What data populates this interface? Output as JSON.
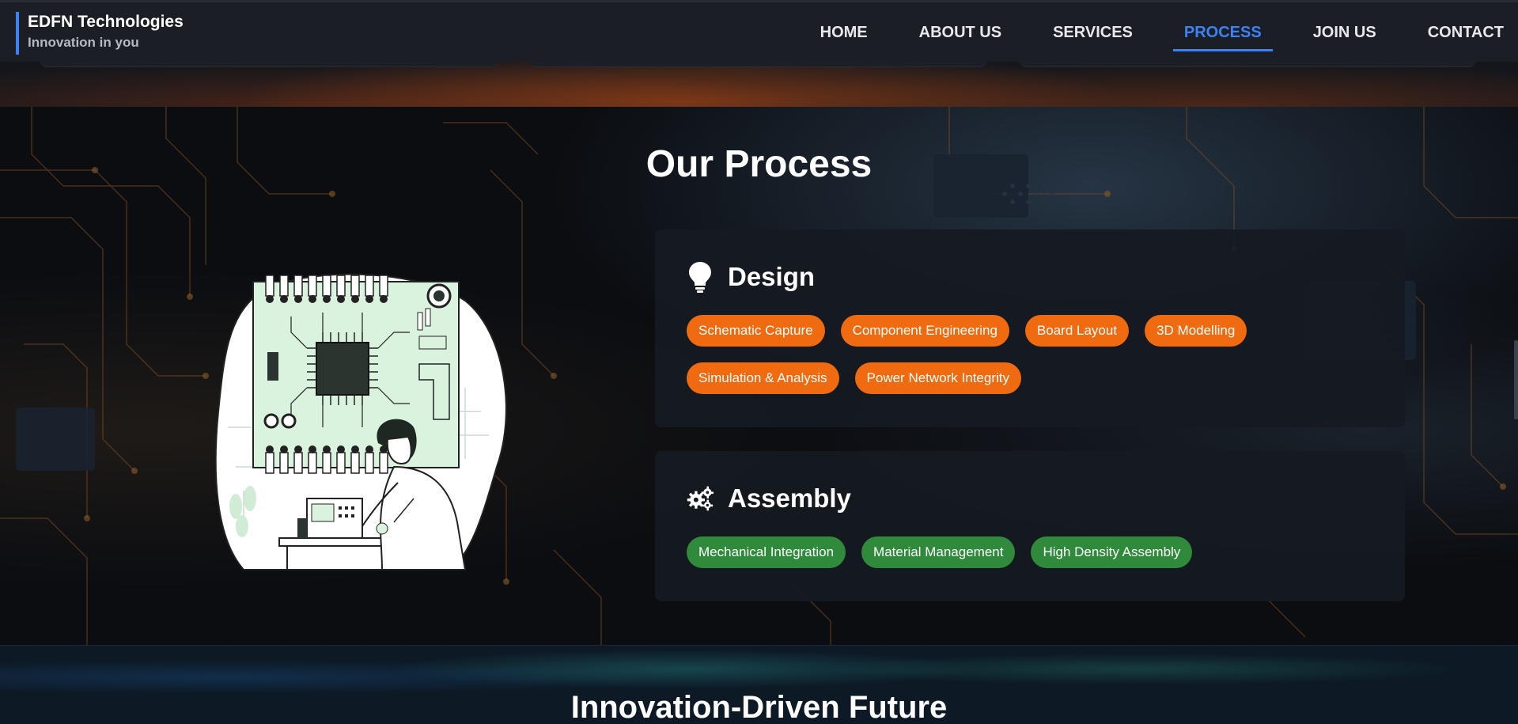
{
  "brand": {
    "name": "EDFN Technologies",
    "tagline": "Innovation in you",
    "accent": "#3b82f6"
  },
  "nav": {
    "items": [
      {
        "label": "HOME",
        "active": false
      },
      {
        "label": "ABOUT US",
        "active": false
      },
      {
        "label": "SERVICES",
        "active": false
      },
      {
        "label": "PROCESS",
        "active": true
      },
      {
        "label": "JOIN US",
        "active": false
      },
      {
        "label": "CONTACT",
        "active": false
      }
    ]
  },
  "process": {
    "title": "Our Process",
    "illustration_icon": "engineer-soldering-pcb-illustration",
    "design": {
      "icon": "lightbulb-icon",
      "title": "Design",
      "pill_color": "#f06a0f",
      "tags": [
        "Schematic Capture",
        "Component Engineering",
        "Board Layout",
        "3D Modelling",
        "Simulation & Analysis",
        "Power Network Integrity"
      ]
    },
    "assembly": {
      "icon": "gears-icon",
      "title": "Assembly",
      "pill_color": "#2f8a3b",
      "tags": [
        "Mechanical Integration",
        "Material Management",
        "High Density Assembly"
      ]
    }
  },
  "next_section": {
    "title": "Innovation-Driven Future"
  }
}
